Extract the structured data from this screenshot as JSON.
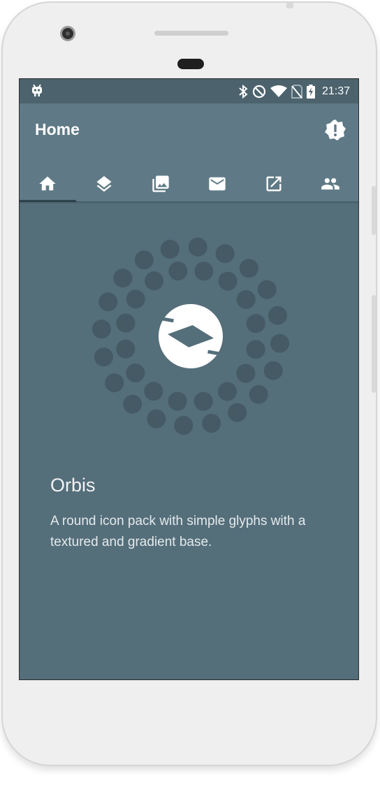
{
  "status_bar": {
    "time": "21:37",
    "left_icon": "android-debug-icon",
    "icons": [
      "bluetooth-icon",
      "do-not-disturb-icon",
      "wifi-icon",
      "no-sim-icon",
      "battery-charging-icon"
    ]
  },
  "app_bar": {
    "title": "Home",
    "action_icon": "alert-badge-icon"
  },
  "tabs": [
    {
      "icon": "home-icon",
      "active": true
    },
    {
      "icon": "layers-icon",
      "active": false
    },
    {
      "icon": "image-gallery-icon",
      "active": false
    },
    {
      "icon": "email-icon",
      "active": false
    },
    {
      "icon": "open-in-new-icon",
      "active": false
    },
    {
      "icon": "people-icon",
      "active": false
    }
  ],
  "content": {
    "title": "Orbis",
    "description": "A round icon pack with simple glyphs with a textured and gradient base."
  },
  "colors": {
    "screen_bg": "#546e7a",
    "app_bar": "#5f7a86",
    "status_bar": "#4c636d",
    "dot": "#455a64"
  }
}
